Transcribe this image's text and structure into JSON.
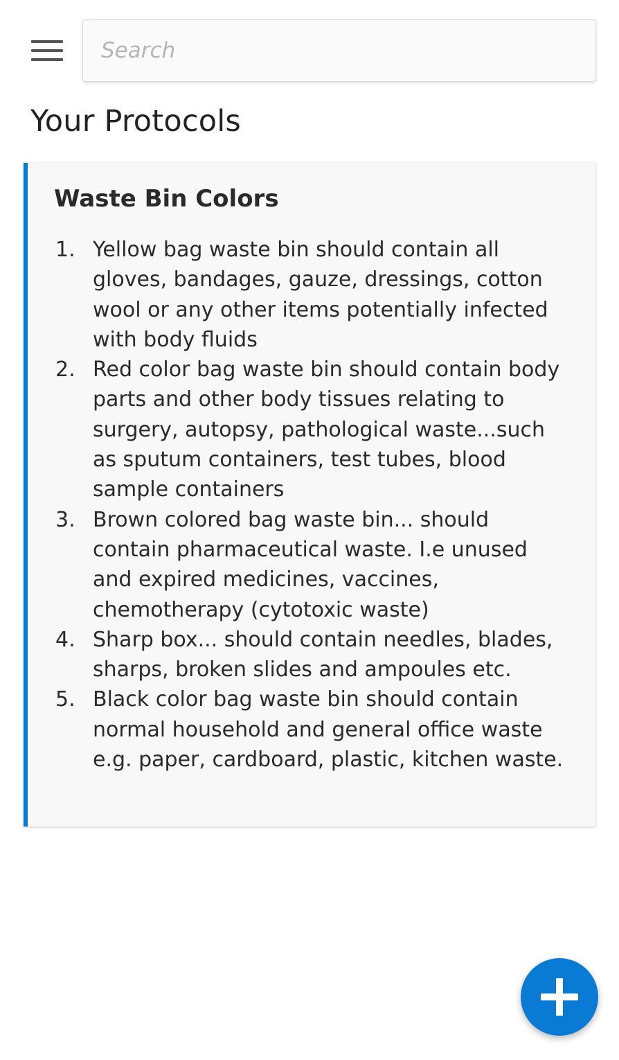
{
  "header": {
    "search_placeholder": "Search"
  },
  "page": {
    "title": "Your Protocols"
  },
  "protocols": [
    {
      "title": "Waste Bin Colors",
      "items": [
        {
          "number": "1.",
          "text": "Yellow bag waste bin should contain all gloves, bandages, gauze, dressings, cotton wool or any other items potentially infected with body fluids"
        },
        {
          "number": "2.",
          "text": "Red color bag waste bin should contain body parts and other body tissues relating to surgery, autopsy, pathological waste...such as sputum containers, test tubes, blood sample containers"
        },
        {
          "number": "3.",
          "text": "Brown colored bag waste bin... should contain pharmaceutical waste. I.e unused and expired medicines, vaccines, chemotherapy (cytotoxic waste)"
        },
        {
          "number": "4.",
          "text": "Sharp box... should contain needles, blades, sharps, broken slides and ampoules etc."
        },
        {
          "number": "5.",
          "text": "Black color bag waste bin should contain normal household and general office waste e.g. paper, cardboard, plastic, kitchen waste."
        }
      ]
    }
  ],
  "icons": {
    "menu": "hamburger-menu-icon",
    "add": "plus-icon"
  },
  "colors": {
    "accent": "#0a7bd4",
    "card_background": "#f8f8f8",
    "text": "#2a2a2a",
    "placeholder": "#b5b5b5"
  }
}
